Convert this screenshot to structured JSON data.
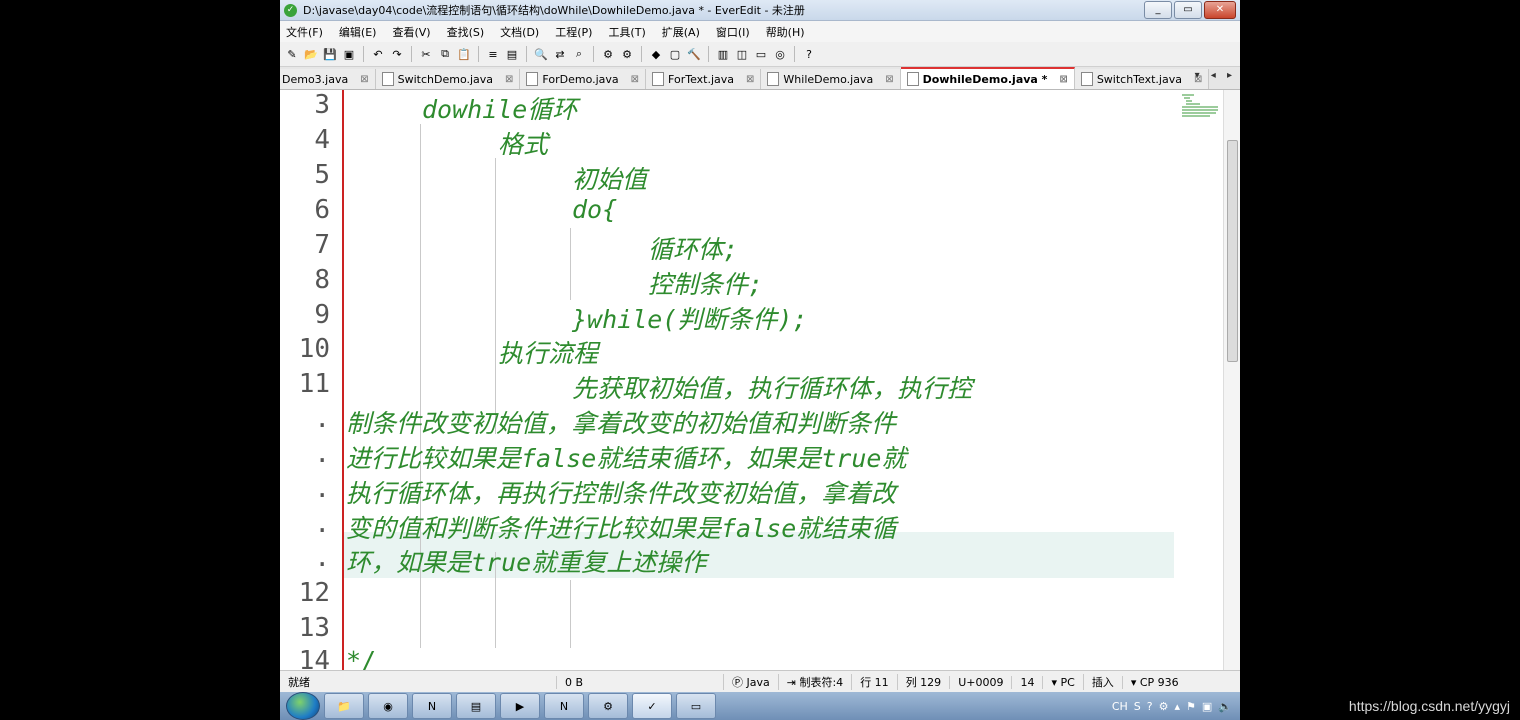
{
  "window": {
    "title": "D:\\javase\\day04\\code\\流程控制语句\\循环结构\\doWhile\\DowhileDemo.java * - EverEdit - 未注册",
    "controls": [
      "_",
      "▭",
      "✕"
    ]
  },
  "menu": [
    "文件(F)",
    "编辑(E)",
    "查看(V)",
    "查找(S)",
    "文档(D)",
    "工程(P)",
    "工具(T)",
    "扩展(A)",
    "窗口(I)",
    "帮助(H)"
  ],
  "tabs": [
    {
      "label": "Demo3.java",
      "active": false
    },
    {
      "label": "SwitchDemo.java",
      "active": false
    },
    {
      "label": "ForDemo.java",
      "active": false
    },
    {
      "label": "ForText.java",
      "active": false
    },
    {
      "label": "WhileDemo.java",
      "active": false
    },
    {
      "label": "DowhileDemo.java *",
      "active": true
    },
    {
      "label": "SwitchText.java",
      "active": false
    }
  ],
  "tab_close": "⊠",
  "tab_nav": "▾ ◂ ▸",
  "line_numbers": [
    "3",
    "4",
    "5",
    "6",
    "7",
    "8",
    "9",
    "10",
    "11",
    ".",
    ".",
    ".",
    ".",
    ".",
    "12",
    "13",
    "14"
  ],
  "code_lines": [
    "dowhile循环",
    "格式",
    "初始值",
    "do{",
    "循环体;",
    "控制条件;",
    "}while(判断条件);",
    "执行流程",
    "先获取初始值，执行循环体，执行控",
    "制条件改变初始值，拿着改变的初始值和判断条件",
    "进行比较如果是false就结束循环，如果是true就",
    "执行循环体，再执行控制条件改变初始值，拿着改",
    "变的值和判断条件进行比较如果是false就结束循",
    "环，如果是true就重复上述操作",
    "*/"
  ],
  "status": {
    "ready": "就绪",
    "size": "0 B",
    "language": "Java",
    "tab_setting": "制表符:4",
    "line": "行 11",
    "column": "列 129",
    "unicode": "U+0009",
    "font_size": "14",
    "eol": "PC",
    "mode": "插入",
    "encoding": "CP 936"
  },
  "taskbar": {
    "tray_lang": "CH"
  },
  "watermark": "https://blog.csdn.net/yygyj",
  "colors": {
    "code_green": "#2e8b2e",
    "gutter_line": "#cc2222",
    "active_tab": "#c00000"
  }
}
